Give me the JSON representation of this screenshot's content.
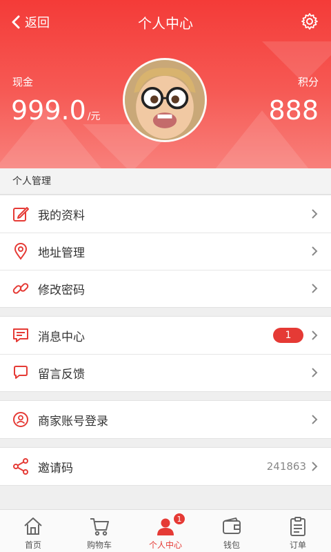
{
  "nav": {
    "back_label": "返回",
    "title": "个人中心"
  },
  "profile": {
    "cash_label": "现金",
    "cash_amount": "999.0",
    "cash_unit": "/元",
    "points_label": "积分",
    "points_value": "888"
  },
  "section": {
    "title": "个人管理"
  },
  "groups": {
    "management": [
      {
        "label": "我的资料",
        "icon": "edit-icon"
      },
      {
        "label": "地址管理",
        "icon": "location-pin-icon"
      },
      {
        "label": "修改密码",
        "icon": "link-icon"
      }
    ],
    "messages": [
      {
        "label": "消息中心",
        "icon": "message-icon",
        "badge": "1"
      },
      {
        "label": "留言反馈",
        "icon": "chat-bubble-icon"
      }
    ],
    "merchant": [
      {
        "label": "商家账号登录",
        "icon": "user-circle-icon"
      }
    ],
    "invite": [
      {
        "label": "邀请码",
        "icon": "share-icon",
        "value": "241863"
      }
    ]
  },
  "tabs": [
    {
      "label": "首页",
      "icon": "home-icon"
    },
    {
      "label": "购物车",
      "icon": "cart-icon"
    },
    {
      "label": "个人中心",
      "icon": "person-icon",
      "badge": "1",
      "active": true
    },
    {
      "label": "钱包",
      "icon": "wallet-icon"
    },
    {
      "label": "订单",
      "icon": "clipboard-icon"
    }
  ],
  "colors": {
    "accent": "#e53a35",
    "header_top": "#f43b38",
    "header_bottom": "#f8807b"
  }
}
